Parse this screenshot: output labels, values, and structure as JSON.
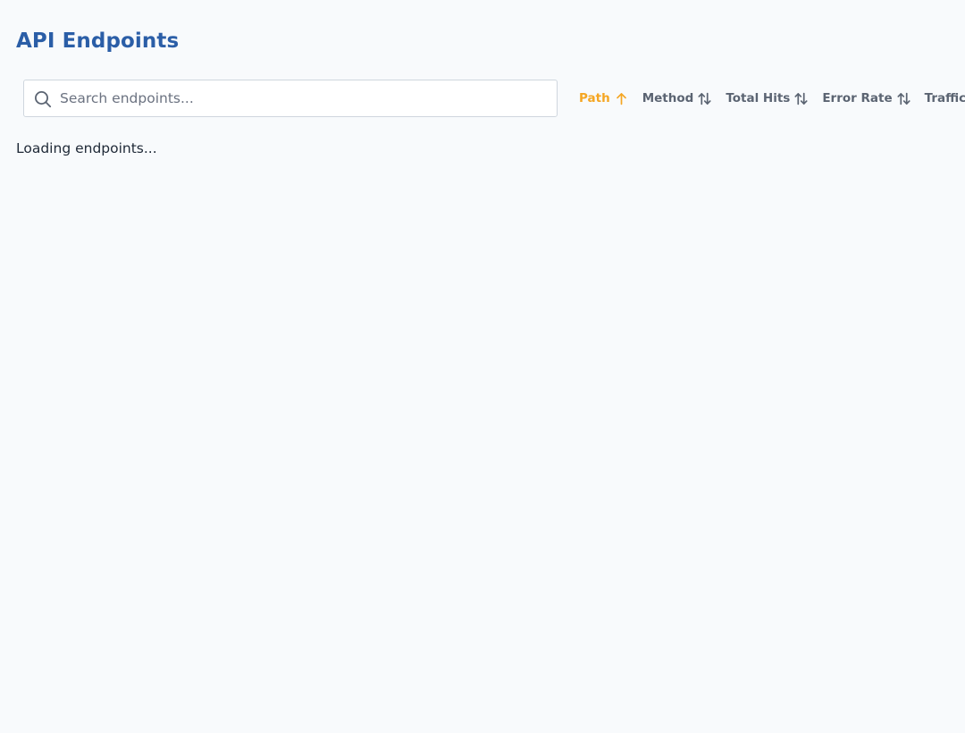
{
  "header": {
    "title": "API Endpoints"
  },
  "search": {
    "placeholder": "Search endpoints...",
    "value": "",
    "icon": "search-icon"
  },
  "sort": {
    "options": [
      {
        "label": "Path",
        "state": "ascending",
        "active": true,
        "icon": "arrow-up-icon"
      },
      {
        "label": "Method",
        "state": "unsorted",
        "active": false,
        "icon": "sort-arrows-icon"
      },
      {
        "label": "Total Hits",
        "state": "unsorted",
        "active": false,
        "icon": "sort-arrows-icon"
      },
      {
        "label": "Error Rate",
        "state": "unsorted",
        "active": false,
        "icon": "sort-arrows-icon"
      },
      {
        "label": "Traffic",
        "state": "unsorted",
        "active": false,
        "icon": "sort-arrows-icon"
      }
    ]
  },
  "status": {
    "loading_text": "Loading endpoints..."
  },
  "colors": {
    "background": "#f8fafc",
    "title": "#2b5ea7",
    "active_sort": "#f5a623",
    "inactive_sort": "#5b6472",
    "text": "#1f2937",
    "placeholder": "#6b7280",
    "input_border": "#cfd6de"
  }
}
